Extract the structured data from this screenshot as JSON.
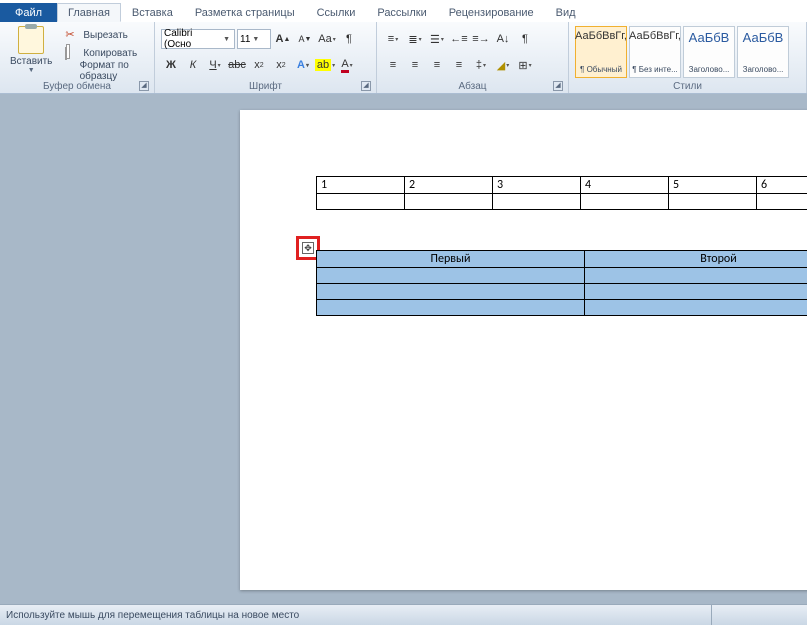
{
  "tabs": {
    "file": "Файл",
    "items": [
      "Главная",
      "Вставка",
      "Разметка страницы",
      "Ссылки",
      "Рассылки",
      "Рецензирование",
      "Вид"
    ],
    "active": 0
  },
  "clipboard": {
    "paste": "Вставить",
    "cut": "Вырезать",
    "copy": "Копировать",
    "fmt": "Формат по образцу",
    "group": "Буфер обмена"
  },
  "font": {
    "name": "Calibri (Осно",
    "size": "11",
    "group": "Шрифт",
    "btns": {
      "bold": "Ж",
      "italic": "К",
      "under": "Ч",
      "strike": "abc",
      "sub": "x",
      "sup": "x",
      "Aa": "Aa",
      "clear": "A",
      "grow": "A",
      "shrink": "A"
    }
  },
  "para": {
    "group": "Абзац"
  },
  "styles": {
    "group": "Стили",
    "list": [
      {
        "sample": "АаБбВвГг,",
        "name": "¶ Обычный"
      },
      {
        "sample": "АаБбВвГг,",
        "name": "¶ Без инте..."
      },
      {
        "sample": "АаБбВ",
        "name": "Заголово..."
      },
      {
        "sample": "АаБбВ",
        "name": "Заголово..."
      }
    ]
  },
  "table1": {
    "row1": [
      "1",
      "2",
      "3",
      "4",
      "5",
      "6"
    ]
  },
  "table2": {
    "headers": [
      "Первый",
      "Второй"
    ]
  },
  "status": "Используйте мышь для перемещения таблицы на новое место"
}
